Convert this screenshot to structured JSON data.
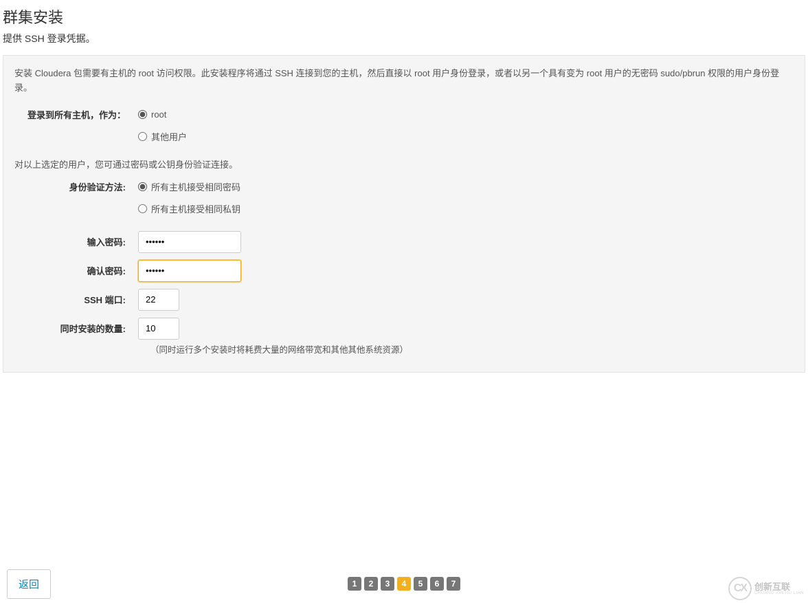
{
  "header": {
    "title": "群集安装",
    "subtitle": "提供 SSH 登录凭据。"
  },
  "info_text": "安装 Cloudera 包需要有主机的 root 访问权限。此安装程序将通过 SSH 连接到您的主机，然后直接以 root 用户身份登录，或者以另一个具有变为 root 用户的无密码 sudo/pbrun 权限的用户身份登录。",
  "login_group": {
    "label": "登录到所有主机，作为：",
    "options": {
      "root": "root",
      "other": "其他用户"
    },
    "selected": "root"
  },
  "auth_intro": "对以上选定的用户，您可通过密码或公钥身份验证连接。",
  "auth_method": {
    "label": "身份验证方法:",
    "options": {
      "password": "所有主机接受相同密码",
      "key": "所有主机接受相同私钥"
    },
    "selected": "password"
  },
  "password": {
    "enter_label": "输入密码:",
    "confirm_label": "确认密码:",
    "value_dots": "••••••",
    "confirm_dots": "••••••"
  },
  "ssh_port": {
    "label": "SSH 端口:",
    "value": "22"
  },
  "concurrent": {
    "label": "同时安装的数量:",
    "value": "10",
    "hint": "（同时运行多个安装时将耗费大量的网络带宽和其他其他系统资源）"
  },
  "footer": {
    "back_label": "返回",
    "pages": [
      "1",
      "2",
      "3",
      "4",
      "5",
      "6",
      "7"
    ],
    "active_page": "4"
  },
  "watermark": {
    "logo_text": "CX",
    "name": "创新互联",
    "sub": "CHUANG XIN HU LIAN"
  }
}
